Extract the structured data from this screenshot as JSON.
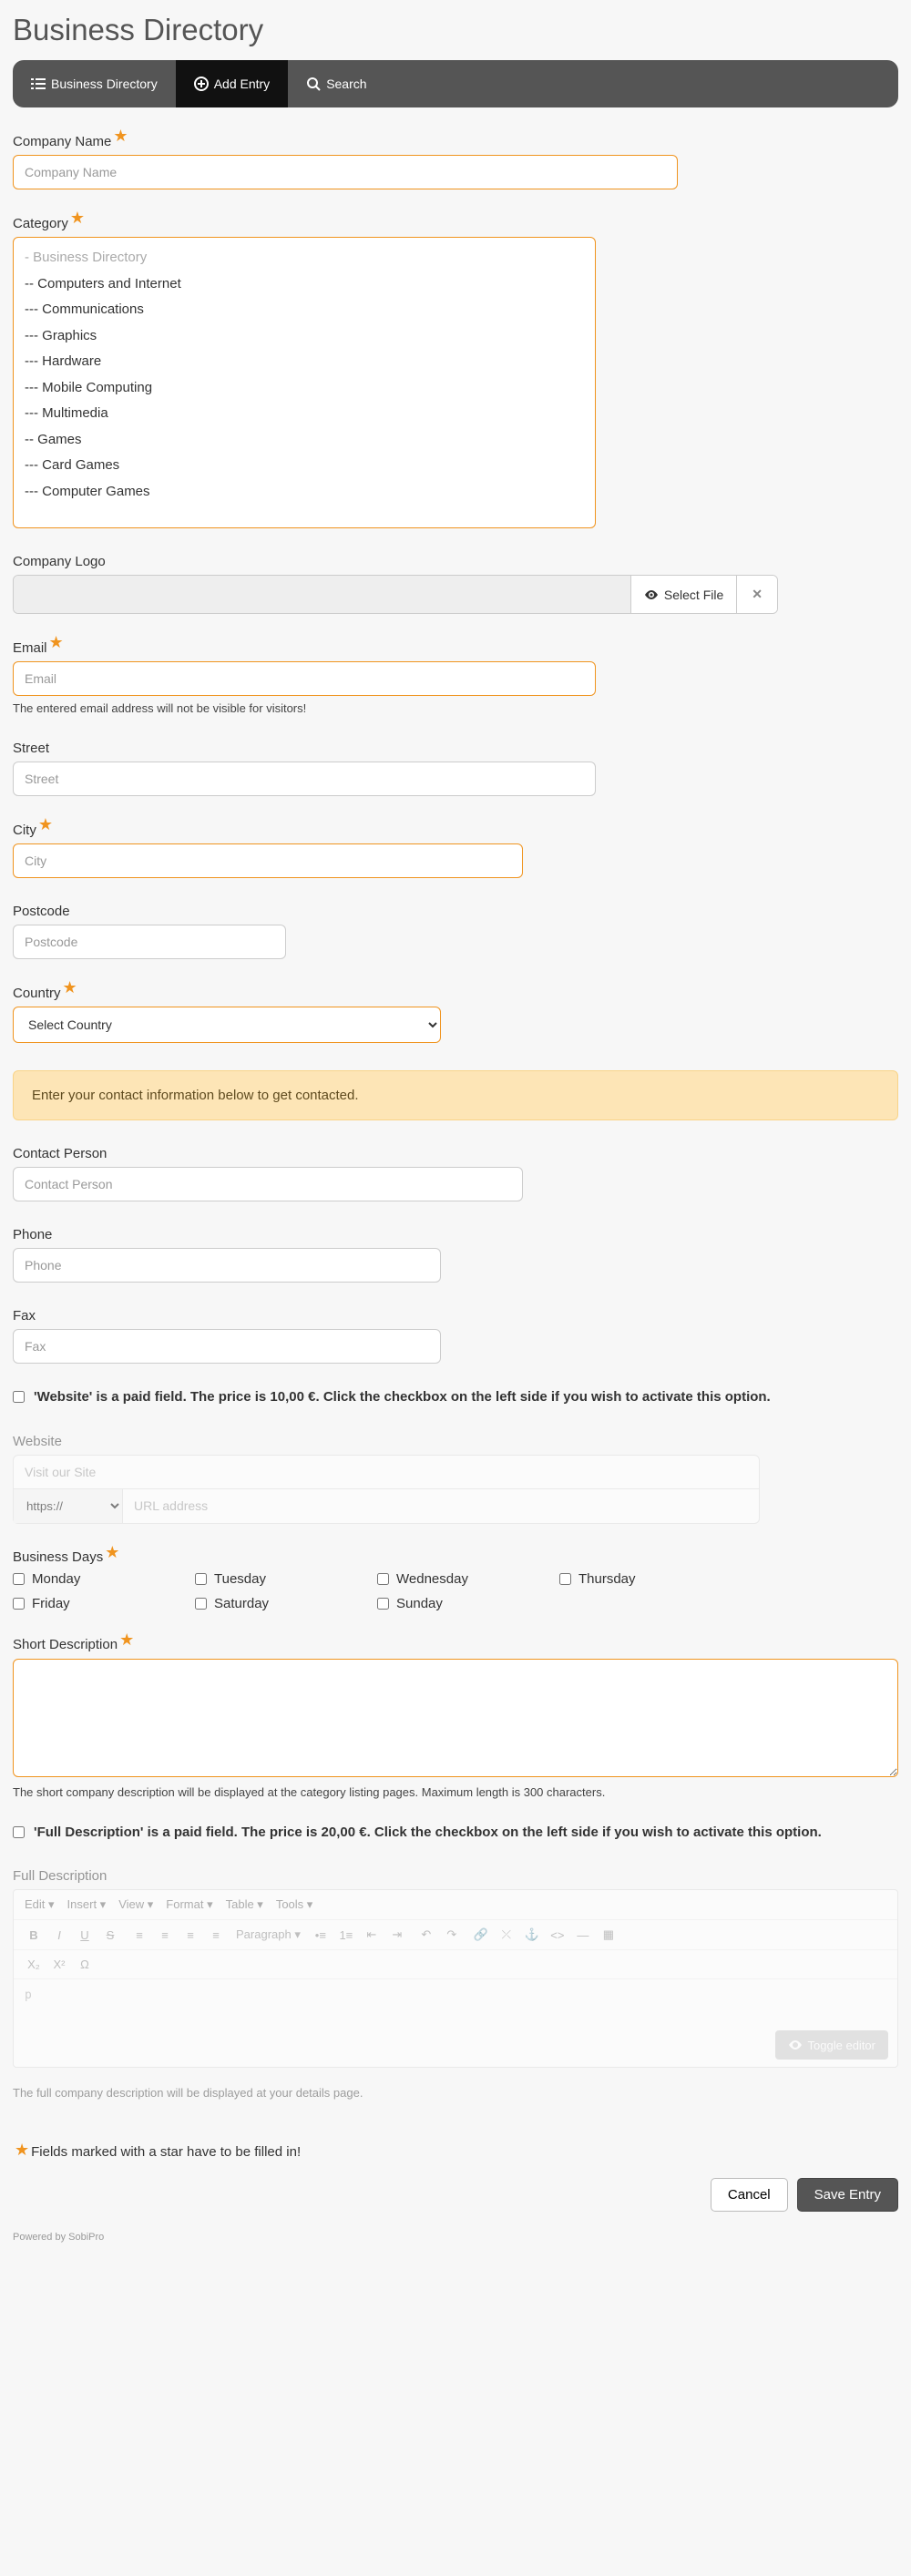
{
  "page_title": "Business Directory",
  "nav": [
    {
      "label": "Business Directory",
      "active": false,
      "icon": "list"
    },
    {
      "label": "Add Entry",
      "active": true,
      "icon": "plus-circle"
    },
    {
      "label": "Search",
      "active": false,
      "icon": "search"
    }
  ],
  "labels": {
    "company_name": "Company Name",
    "category": "Category",
    "company_logo": "Company Logo",
    "email": "Email",
    "street": "Street",
    "city": "City",
    "postcode": "Postcode",
    "country": "Country",
    "contact_person": "Contact Person",
    "phone": "Phone",
    "fax": "Fax",
    "website": "Website",
    "business_days": "Business Days",
    "short_desc": "Short Description",
    "full_desc": "Full Description"
  },
  "placeholders": {
    "company_name": "Company Name",
    "email": "Email",
    "street": "Street",
    "city": "City",
    "postcode": "Postcode",
    "country": "Select Country",
    "contact_person": "Contact Person",
    "phone": "Phone",
    "fax": "Fax",
    "visit": "Visit our Site",
    "url": "URL address",
    "protocol": "https://"
  },
  "buttons": {
    "select_file": "Select File",
    "toggle_editor": "Toggle editor",
    "cancel": "Cancel",
    "save": "Save Entry"
  },
  "category_options": [
    {
      "label": "- Business Directory",
      "muted": true
    },
    {
      "label": "-- Computers and Internet"
    },
    {
      "label": "--- Communications"
    },
    {
      "label": "--- Graphics"
    },
    {
      "label": "--- Hardware"
    },
    {
      "label": "--- Mobile Computing"
    },
    {
      "label": "--- Multimedia"
    },
    {
      "label": "-- Games"
    },
    {
      "label": "--- Card Games"
    },
    {
      "label": "--- Computer Games"
    }
  ],
  "email_help": "The entered email address will not be visible for visitors!",
  "contact_callout": "Enter your contact information below to get contacted.",
  "paid_website_text": "'Website' is a paid field. The price is 10,00 €. Click the checkbox on the left side if you wish to activate this option.",
  "paid_fulldesc_text": "'Full Description' is a paid field. The price is 20,00 €. Click the checkbox on the left side if you wish to activate this option.",
  "days": [
    "Monday",
    "Tuesday",
    "Wednesday",
    "Thursday",
    "Friday",
    "Saturday",
    "Sunday"
  ],
  "short_desc_help": "The short company description will be displayed at the category listing pages. Maximum length is 300 characters.",
  "full_desc_help": "The full company description will be displayed at your details page.",
  "editor_menu": [
    "Edit",
    "Insert",
    "View",
    "Format",
    "Table",
    "Tools"
  ],
  "editor_paragraph": "Paragraph",
  "editor_body_placeholder": "p",
  "required_note": "Fields marked with a star have to be filled in!",
  "powered": "Powered by SobiPro"
}
